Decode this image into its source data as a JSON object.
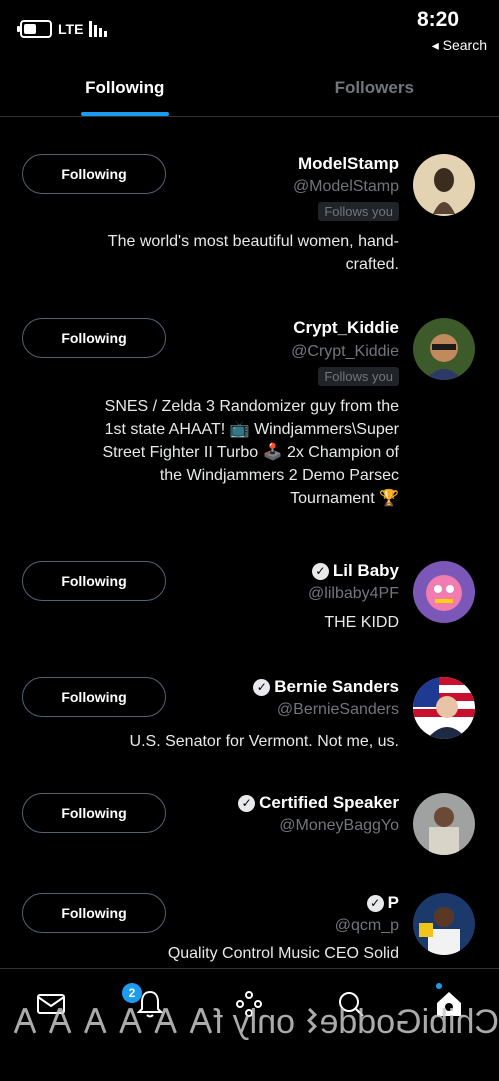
{
  "status_bar": {
    "time": "8:20",
    "back_label": "◂ Search",
    "network": "LTE",
    "signal_bars": 4
  },
  "tabs": [
    {
      "label": "Following",
      "active": true
    },
    {
      "label": "Followers",
      "active": false
    }
  ],
  "users": [
    {
      "name": "ModelStamp",
      "handle": "@ModelStamp",
      "verified": false,
      "follows_you": "Follows you",
      "bio": "The world's most beautiful women, hand-crafted.",
      "button": "Following"
    },
    {
      "name": "Crypt_Kiddie",
      "handle": "@Crypt_Kiddie",
      "verified": false,
      "follows_you": "Follows you",
      "bio": "SNES / Zelda 3 Randomizer guy from the 1st state AHAAT! 📺 Windjammers\\Super Street Fighter II Turbo 🕹️ 2x Champion of the Windjammers 2 Demo Parsec Tournament 🏆",
      "button": "Following"
    },
    {
      "name": "Lil Baby",
      "handle": "@lilbaby4PF",
      "verified": true,
      "follows_you": "",
      "bio": "THE KIDD",
      "button": "Following"
    },
    {
      "name": "Bernie Sanders",
      "handle": "@BernieSanders",
      "verified": true,
      "follows_you": "",
      "bio": "U.S. Senator for Vermont. Not me, us.",
      "button": "Following"
    },
    {
      "name": "Certified Speaker",
      "handle": "@MoneyBaggYo",
      "verified": true,
      "follows_you": "",
      "bio": "",
      "button": "Following"
    },
    {
      "name": "P",
      "handle": "@qcm_p",
      "verified": true,
      "follows_you": "",
      "bio": "Quality Control Music CEO Solid",
      "button": "Following"
    }
  ],
  "bottom_nav": {
    "icons": [
      "home-icon",
      "search-icon",
      "spaces-icon",
      "notifications-icon",
      "messages-icon"
    ],
    "notification_count": "2"
  },
  "overlay_text": "ChibiGodde𐌔 only f𐌀 𐌀 𐌀 𐌀 𐌀 𐌀 "
}
